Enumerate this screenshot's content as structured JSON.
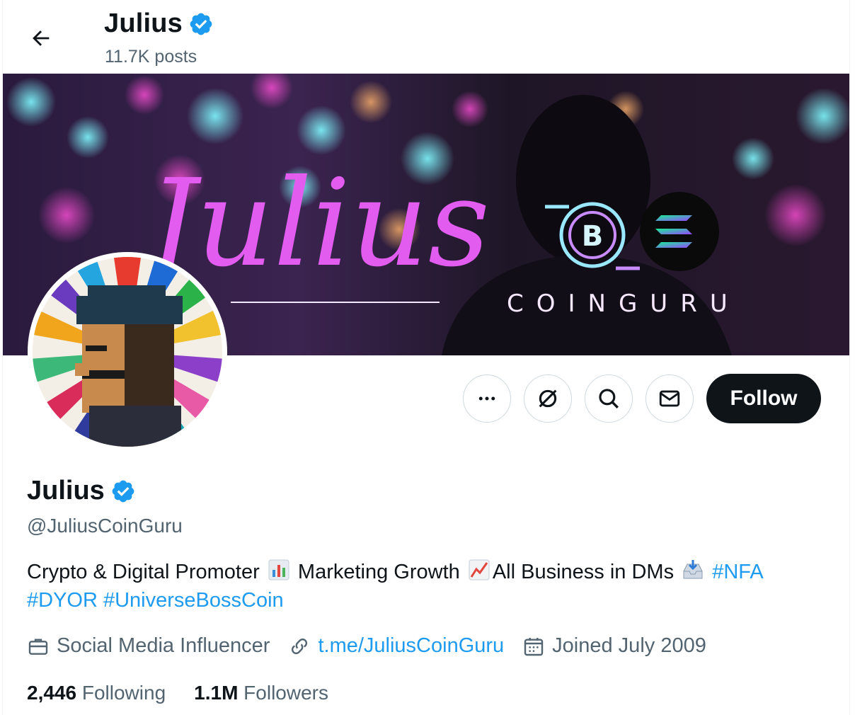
{
  "header": {
    "name": "Julius",
    "posts": "11.7K posts"
  },
  "banner": {
    "script_text": "Julius",
    "brand_text": "COINGURU"
  },
  "profile": {
    "name": "Julius",
    "handle": "@JuliusCoinGuru",
    "bio": {
      "part1": "Crypto & Digital Promoter",
      "part2": "Marketing Growth",
      "part3": "All Business in DMs",
      "tag1": "#NFA",
      "tag2": "#DYOR",
      "tag3": "#UniverseBossCoin"
    },
    "category": "Social Media Influencer",
    "link": "t.me/JuliusCoinGuru",
    "joined": "Joined July 2009",
    "following_count": "2,446",
    "following_label": "Following",
    "followers_count": "1.1M",
    "followers_label": "Followers"
  },
  "actions": {
    "follow_label": "Follow"
  },
  "icons": [
    "back-arrow-icon",
    "verified-badge-icon",
    "more-icon",
    "grok-icon",
    "search-icon",
    "mail-icon",
    "briefcase-icon",
    "link-icon",
    "calendar-icon",
    "bar-chart-emoji",
    "chart-up-emoji",
    "inbox-tray-emoji"
  ],
  "colors": {
    "accent": "#1d9bf0",
    "text": "#0f1419",
    "muted": "#536471",
    "follow_bg": "#0f1419"
  }
}
